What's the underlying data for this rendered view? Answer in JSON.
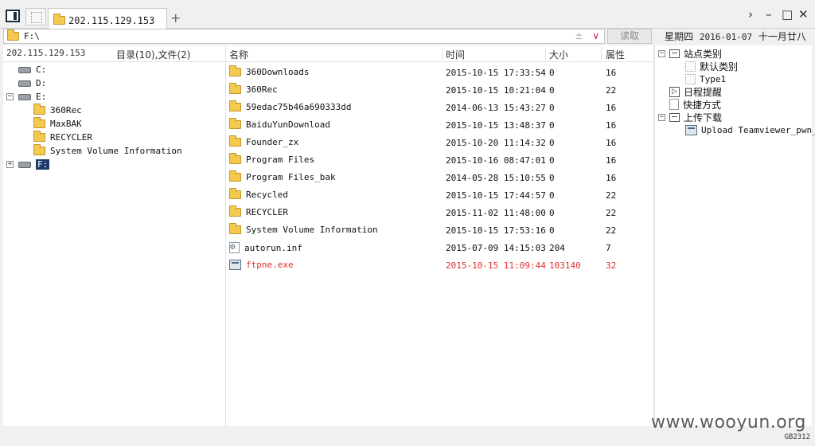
{
  "tab": {
    "title": "202.115.129.153"
  },
  "window_controls": {
    "forward": "›",
    "minimize": "–",
    "maximize": "□",
    "close": "✕"
  },
  "pathbar": {
    "path": "F:\\",
    "add": "±",
    "dropdown": "∨",
    "read_button": "读取"
  },
  "date": {
    "weekday": "星期四",
    "date": "2016-01-07",
    "lunar": "十一月廿八"
  },
  "left_panel": {
    "host": "202.115.129.153",
    "counts": "目录(10),文件(2)",
    "tree": [
      {
        "label": "C:",
        "type": "drive",
        "expander": "",
        "depth": 0
      },
      {
        "label": "D:",
        "type": "drive",
        "expander": "",
        "depth": 0
      },
      {
        "label": "E:",
        "type": "drive",
        "expander": "−",
        "depth": 0
      },
      {
        "label": "360Rec",
        "type": "folder",
        "expander": "",
        "depth": 1
      },
      {
        "label": "MaxBAK",
        "type": "folder",
        "expander": "",
        "depth": 1
      },
      {
        "label": "RECYCLER",
        "type": "folder",
        "expander": "",
        "depth": 1
      },
      {
        "label": "System Volume Information",
        "type": "folder",
        "expander": "",
        "depth": 1
      },
      {
        "label": "F:",
        "type": "drive",
        "expander": "+",
        "depth": 0,
        "selected": true
      }
    ]
  },
  "table": {
    "columns": {
      "name": "名称",
      "time": "时间",
      "size": "大小",
      "attr": "属性"
    },
    "rows": [
      {
        "name": "360Downloads",
        "time": "2015-10-15 17:33:54",
        "size": "0",
        "attr": "16",
        "type": "folder"
      },
      {
        "name": "360Rec",
        "time": "2015-10-15 10:21:04",
        "size": "0",
        "attr": "22",
        "type": "folder"
      },
      {
        "name": "59edac75b46a690333dd",
        "time": "2014-06-13 15:43:27",
        "size": "0",
        "attr": "16",
        "type": "folder"
      },
      {
        "name": "BaiduYunDownload",
        "time": "2015-10-15 13:48:37",
        "size": "0",
        "attr": "16",
        "type": "folder"
      },
      {
        "name": "Founder_zx",
        "time": "2015-10-20 11:14:32",
        "size": "0",
        "attr": "16",
        "type": "folder"
      },
      {
        "name": "Program Files",
        "time": "2015-10-16 08:47:01",
        "size": "0",
        "attr": "16",
        "type": "folder"
      },
      {
        "name": "Program Files_bak",
        "time": "2014-05-28 15:10:55",
        "size": "0",
        "attr": "16",
        "type": "folder"
      },
      {
        "name": "Recycled",
        "time": "2015-10-15 17:44:57",
        "size": "0",
        "attr": "22",
        "type": "folder"
      },
      {
        "name": "RECYCLER",
        "time": "2015-11-02 11:48:00",
        "size": "0",
        "attr": "22",
        "type": "folder"
      },
      {
        "name": "System Volume Information",
        "time": "2015-10-15 17:53:16",
        "size": "0",
        "attr": "22",
        "type": "folder"
      },
      {
        "name": "autorun.inf",
        "time": "2015-07-09 14:15:03",
        "size": "204",
        "attr": "7",
        "type": "file"
      },
      {
        "name": "ftpne.exe",
        "time": "2015-10-15 11:09:44",
        "size": "103140",
        "attr": "32",
        "type": "exe",
        "highlight": true
      }
    ]
  },
  "right_panel": {
    "tree": [
      {
        "label": "站点类别",
        "icon": "box",
        "expander": "−",
        "depth": 0
      },
      {
        "label": "默认类别",
        "icon": "dotted",
        "expander": "",
        "depth": 1
      },
      {
        "label": "Type1",
        "icon": "dotted",
        "expander": "",
        "depth": 1
      },
      {
        "label": "日程提醒",
        "icon": "schedule",
        "expander": "",
        "depth": 0
      },
      {
        "label": "快捷方式",
        "icon": "shortcut",
        "expander": "",
        "depth": 0
      },
      {
        "label": "上传下载",
        "icon": "box",
        "expander": "−",
        "depth": 0
      },
      {
        "label": "Upload Teamviewer_pwn_C",
        "icon": "exe",
        "expander": "",
        "depth": 1
      }
    ]
  },
  "status": {
    "watermark": "www.wooyun.org",
    "encoding": "GB2312"
  },
  "colors": {
    "highlight_row": "#e03030",
    "selection": "#1c3b6b",
    "folder": "#f3c94e"
  }
}
